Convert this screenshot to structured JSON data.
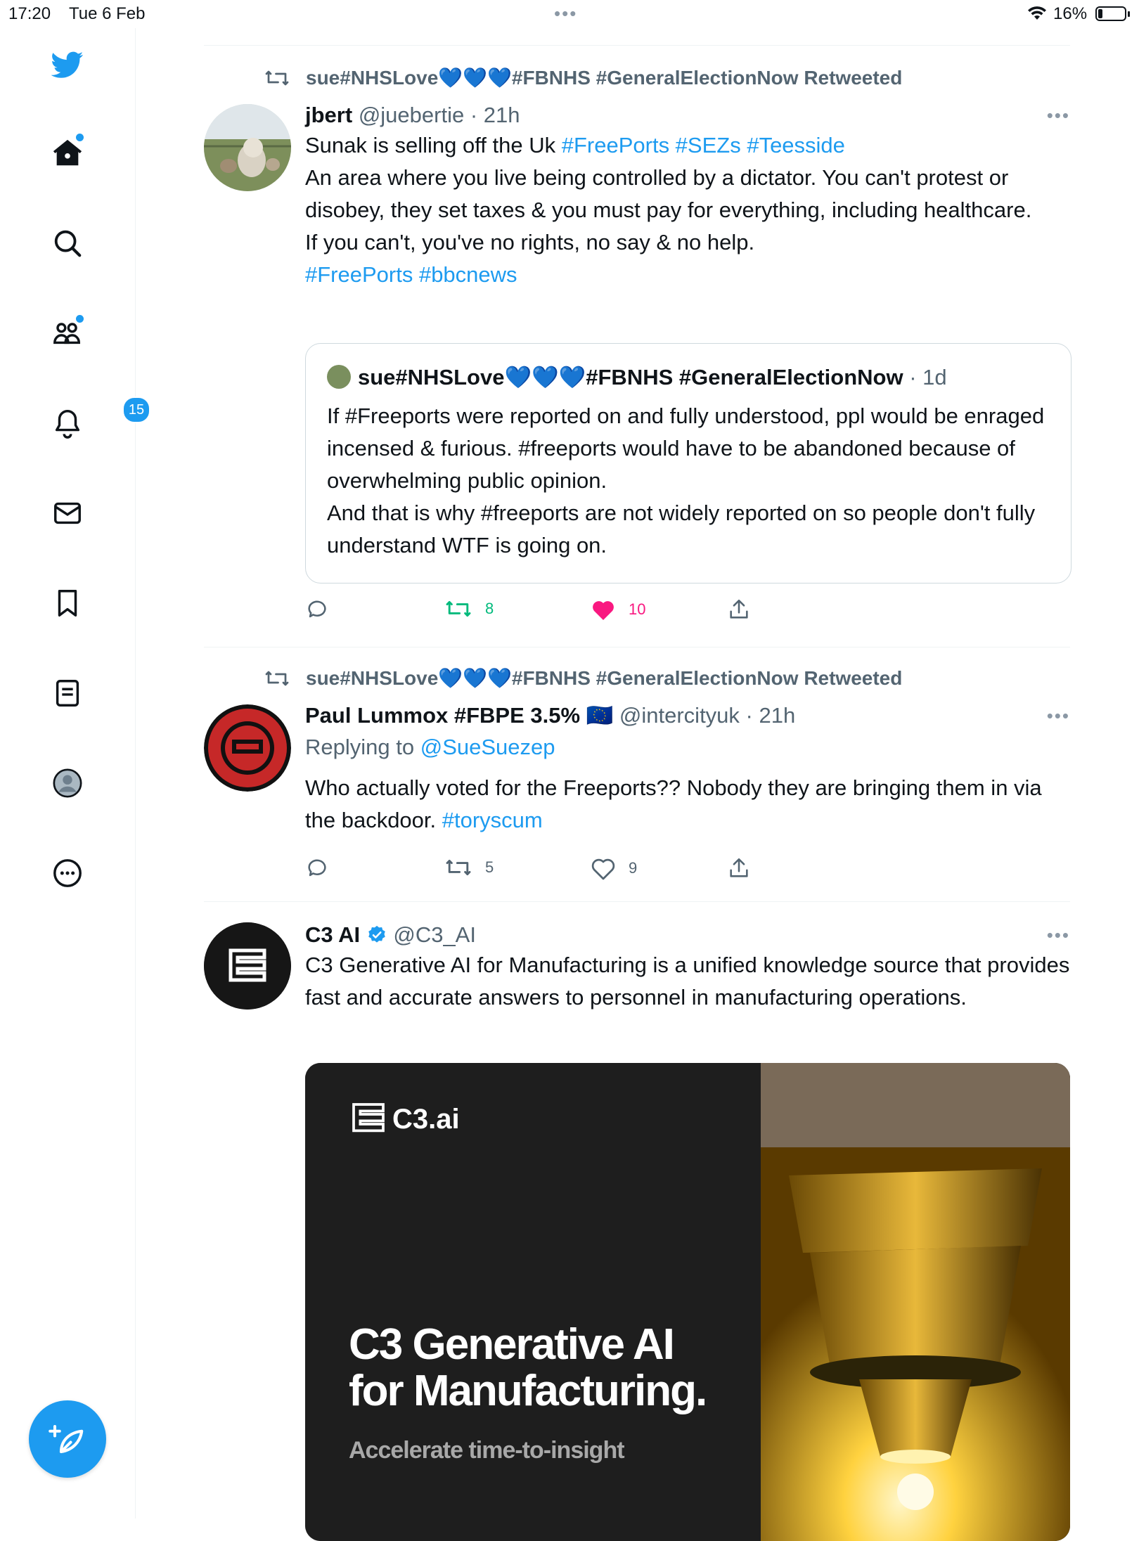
{
  "status": {
    "time": "17:20",
    "date": "Tue 6 Feb",
    "battery": "16%"
  },
  "nav": {
    "notifications_count": "15"
  },
  "tweets": [
    {
      "retweeted_by": "sue#NHSLove💙💙💙#FBNHS #GeneralElectionNow Retweeted",
      "name": "jbert",
      "handle": "@juebertie",
      "time": "· 21h",
      "line1": "Sunak is selling off the Uk ",
      "tags1": "#FreePorts #SEZs #Teesside",
      "line2": "An area where you live being controlled by a dictator. You can't protest or disobey, they set taxes & you must pay for everything, including healthcare.",
      "line3": "If you can't, you've no rights, no say & no help.",
      "tags2": "#FreePorts #bbcnews",
      "quote": {
        "name": "sue#NHSLove💙💙💙#FBNHS #GeneralElectionNow",
        "time": "· 1d",
        "text1": "If #Freeports were reported on and fully understood, ppl would be enraged incensed & furious. #freeports would have to be abandoned because of overwhelming public opinion.",
        "text2": "And that is why #freeports are not widely reported on so people don't fully understand WTF is going on."
      },
      "retweets": "8",
      "likes": "10"
    },
    {
      "retweeted_by": "sue#NHSLove💙💙💙#FBNHS #GeneralElectionNow Retweeted",
      "name": "Paul Lummox #FBPE 3.5% 🇪🇺",
      "handle": "@intercityuk",
      "time": "· 21h",
      "replying_label": "Replying to ",
      "replying_to": "@SueSuezep",
      "text": "Who actually voted for the Freeports?? Nobody they are bringing them in via the backdoor. ",
      "tag": "#toryscum",
      "retweets": "5",
      "likes": "9"
    },
    {
      "name": "C3 AI",
      "handle": "@C3_AI",
      "text": "C3 Generative AI for Manufacturing is a unified knowledge source that provides fast and accurate answers to personnel in manufacturing operations.",
      "ad": {
        "logo": "C3.ai",
        "headline1": "C3 Generative AI",
        "headline2": "for Manufacturing.",
        "subline": "Accelerate time-to-insight"
      }
    }
  ]
}
